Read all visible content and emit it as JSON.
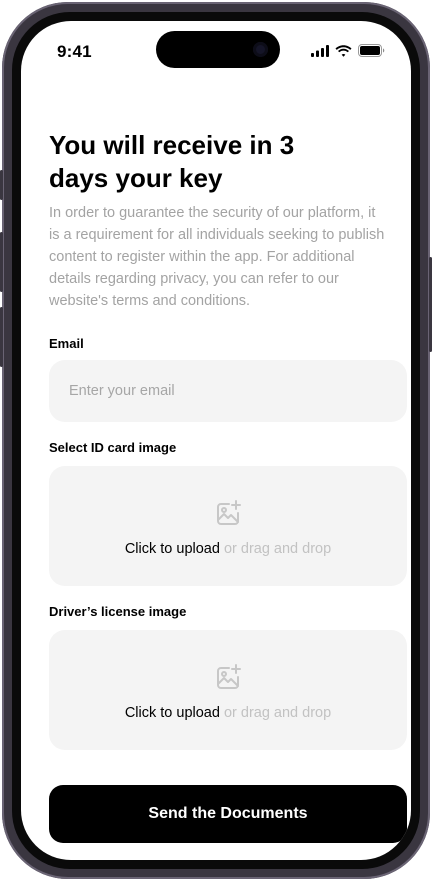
{
  "status_bar": {
    "time": "9:41"
  },
  "heading": "You will receive in 3 days your key",
  "description": "In order to guarantee the security of our platform, it is a requirement for all individuals seeking to publish content to register within the app. For additional details regarding privacy, you can refer to our website's terms and conditions.",
  "email": {
    "label": "Email",
    "placeholder": "Enter your email",
    "value": ""
  },
  "id_card": {
    "label": "Select ID card image",
    "upload_label": "Click to upload",
    "upload_hint": "or drag and drop",
    "icon": "image-add-icon"
  },
  "drivers_license": {
    "label": "Driver’s license image",
    "upload_label": "Click to upload",
    "upload_hint": "or drag and drop",
    "icon": "image-add-icon"
  },
  "submit": {
    "label": "Send the Documents"
  },
  "colors": {
    "primary": "#000000",
    "field_bg": "#f4f4f4",
    "muted_text": "#a3a3a3",
    "hint_text": "#c2c2c2"
  }
}
